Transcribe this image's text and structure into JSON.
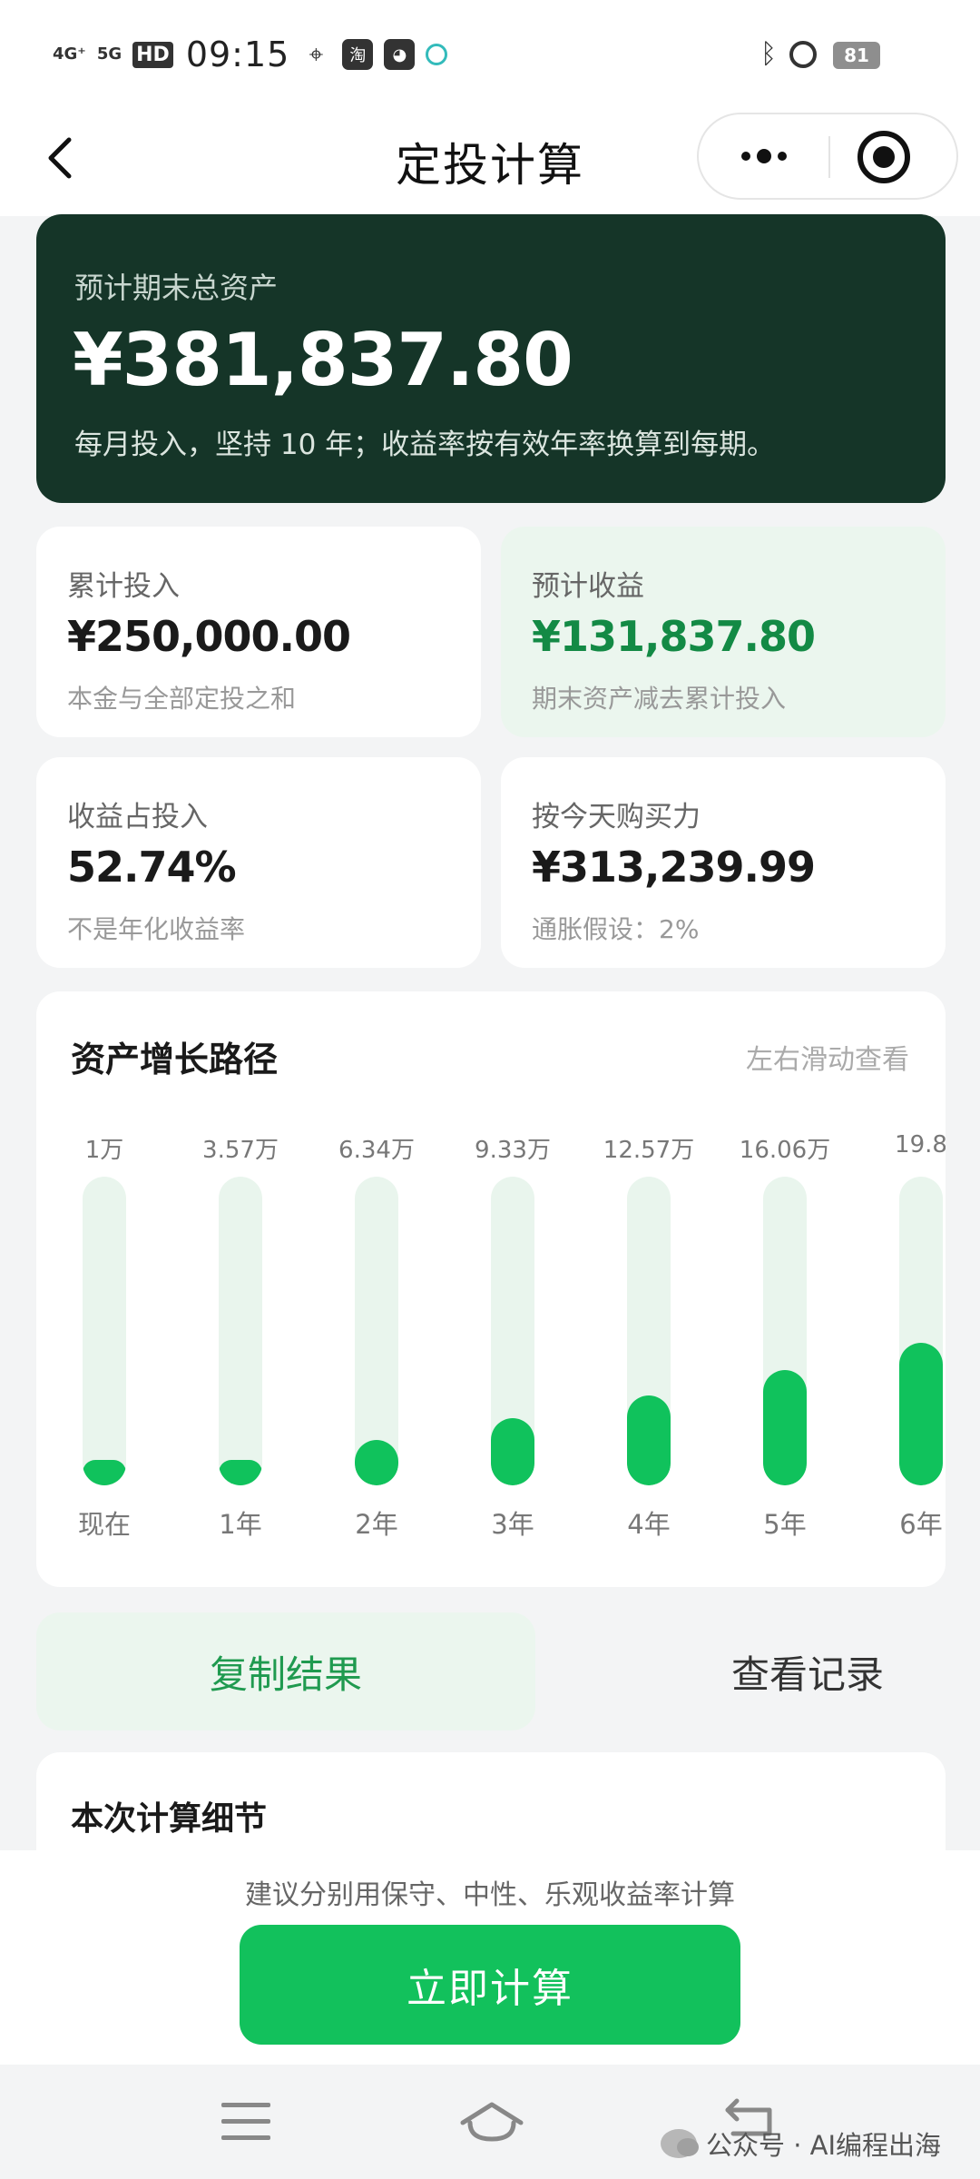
{
  "status_bar": {
    "signal_1": "4G⁺",
    "signal_2": "5G",
    "hd": "HD",
    "time": "09:15",
    "taobao": "淘",
    "battery": "81"
  },
  "nav": {
    "title": "定投计算"
  },
  "hero": {
    "label": "预计期末总资产",
    "value": "¥381,837.80",
    "note": "每月投入，坚持 10 年；收益率按有效年率换算到每期。"
  },
  "stats": [
    {
      "label": "累计投入",
      "value": "¥250,000.00",
      "sub": "本金与全部定投之和"
    },
    {
      "label": "预计收益",
      "value": "¥131,837.80",
      "sub": "期末资产减去累计投入"
    },
    {
      "label": "收益占投入",
      "value": "52.74%",
      "sub": "不是年化收益率"
    },
    {
      "label": "按今天购买力",
      "value": "¥313,239.99",
      "sub": "通胀假设：2%"
    }
  ],
  "chart": {
    "title": "资产增长路径",
    "hint": "左右滑动查看"
  },
  "chart_data": {
    "type": "bar",
    "categories": [
      "现在",
      "1年",
      "2年",
      "3年",
      "4年",
      "5年",
      "6年"
    ],
    "value_labels": [
      "1万",
      "3.57万",
      "6.34万",
      "9.33万",
      "12.57万",
      "16.06万",
      "19.8"
    ],
    "values": [
      1,
      3.57,
      6.34,
      9.33,
      12.57,
      16.06,
      19.8
    ],
    "unit": "万",
    "colors": {
      "fill": "#10c25c",
      "track": "#e9f5ed"
    }
  },
  "actions": {
    "copy": "复制结果",
    "records": "查看记录"
  },
  "details": {
    "title": "本次计算细节"
  },
  "bottom": {
    "hint": "建议分别用保守、中性、乐观收益率计算",
    "calc_button": "立即计算"
  },
  "watermark": {
    "text": "公众号 · AI编程出海"
  },
  "colors": {
    "primary": "#12c15c",
    "hero_bg": "#153528",
    "accent_text": "#138a45"
  }
}
